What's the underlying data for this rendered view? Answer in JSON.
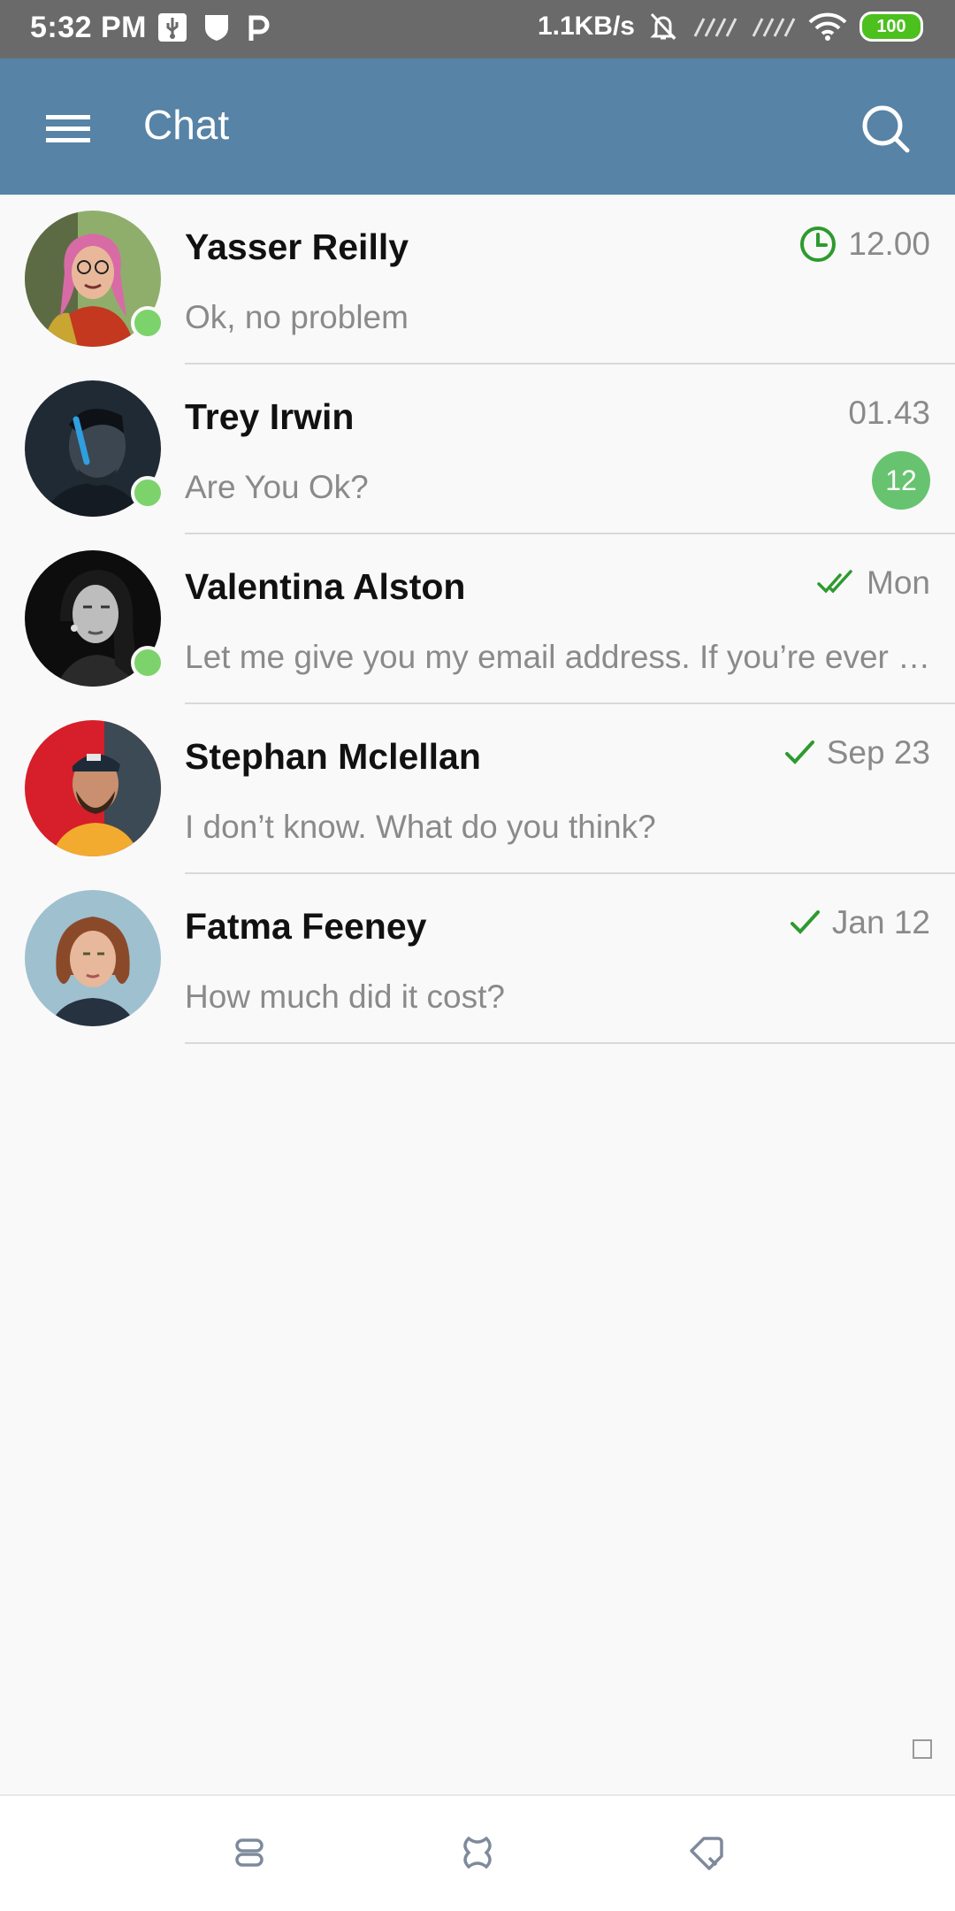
{
  "status_bar": {
    "time": "5:32 PM",
    "net_speed": "1.1KB/s",
    "battery": "100",
    "left_icons": [
      "usb-icon",
      "shield-icon",
      "p-icon"
    ],
    "right_icons": [
      "mute-bell-icon",
      "signal-icon",
      "signal-icon",
      "wifi-icon",
      "battery-icon"
    ]
  },
  "app_bar": {
    "title": "Chat",
    "menu_icon": "hamburger-menu-icon",
    "search_icon": "search-icon",
    "background": "#5683a6"
  },
  "chats": [
    {
      "name": "Yasser Reilly",
      "preview": "Ok, no problem",
      "time": "12.00",
      "status_icon": "clock-icon",
      "online": true,
      "unread": null
    },
    {
      "name": "Trey Irwin",
      "preview": "Are You Ok?",
      "time": "01.43",
      "status_icon": null,
      "online": true,
      "unread": "12"
    },
    {
      "name": "Valentina Alston",
      "preview": "Let me give you my email address. If you’re ever in town, send me an email",
      "time": "Mon",
      "status_icon": "double-check-icon",
      "online": true,
      "unread": null
    },
    {
      "name": "Stephan Mclellan",
      "preview": "I don’t know. What do you think?",
      "time": "Sep 23",
      "status_icon": "check-icon",
      "online": false,
      "unread": null
    },
    {
      "name": "Fatma Feeney",
      "preview": "How much did it cost?",
      "time": "Jan 12",
      "status_icon": "check-icon",
      "online": false,
      "unread": null
    }
  ],
  "bottom_nav": [
    "recents-icon",
    "home-icon",
    "back-icon"
  ],
  "colors": {
    "accent_green": "#3a9a3a",
    "online_green": "#7cd36b",
    "badge_green": "#67c36f"
  }
}
